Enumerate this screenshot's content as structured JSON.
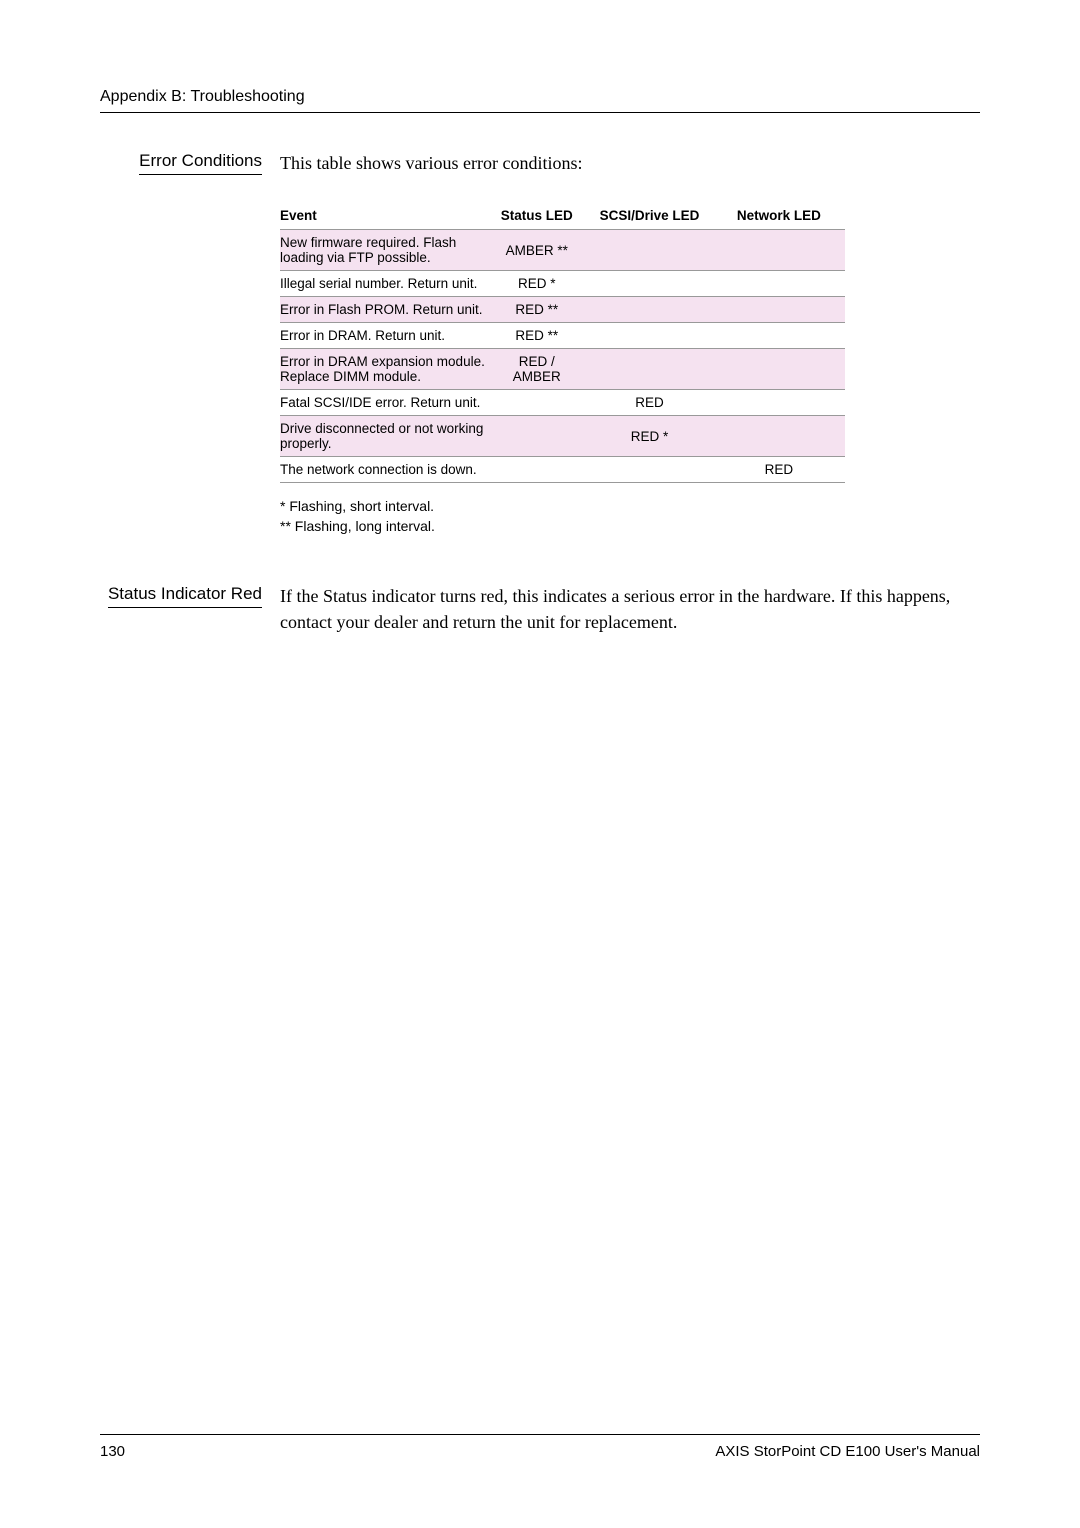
{
  "header": {
    "title": "Appendix B: Troubleshooting"
  },
  "section1": {
    "heading": "Error Conditions",
    "intro": "This table shows various error conditions:",
    "table": {
      "headers": {
        "event": "Event",
        "status": "Status LED",
        "scsi": "SCSI/Drive LED",
        "network": "Network LED"
      },
      "rows": [
        {
          "event": "New firmware required. Flash loading via FTP possible.",
          "status": "AMBER **",
          "scsi": "",
          "network": "",
          "shade": true
        },
        {
          "event": "Illegal serial number. Return unit.",
          "status": "RED *",
          "scsi": "",
          "network": "",
          "shade": false
        },
        {
          "event": "Error in Flash PROM. Return unit.",
          "status": "RED **",
          "scsi": "",
          "network": "",
          "shade": true
        },
        {
          "event": "Error in DRAM. Return unit.",
          "status": "RED **",
          "scsi": "",
          "network": "",
          "shade": false
        },
        {
          "event": "Error in DRAM expansion module. Replace DIMM module.",
          "status": "RED / AMBER",
          "scsi": "",
          "network": "",
          "shade": true
        },
        {
          "event": "Fatal SCSI/IDE error. Return unit.",
          "status": "",
          "scsi": "RED",
          "network": "",
          "shade": false
        },
        {
          "event": "Drive disconnected or not working properly.",
          "status": "",
          "scsi": "RED *",
          "network": "",
          "shade": true
        },
        {
          "event": "The network connection is down.",
          "status": "",
          "scsi": "",
          "network": "RED",
          "shade": false
        }
      ]
    },
    "legend1": "* Flashing, short interval.",
    "legend2": "** Flashing, long interval."
  },
  "section2": {
    "heading": "Status Indicator Red",
    "body": "If the Status indicator turns red, this indicates a serious error in the hardware. If this happens, contact your dealer and return the unit for replacement."
  },
  "footer": {
    "page": "130",
    "title": "AXIS StorPoint CD E100 User's Manual"
  }
}
